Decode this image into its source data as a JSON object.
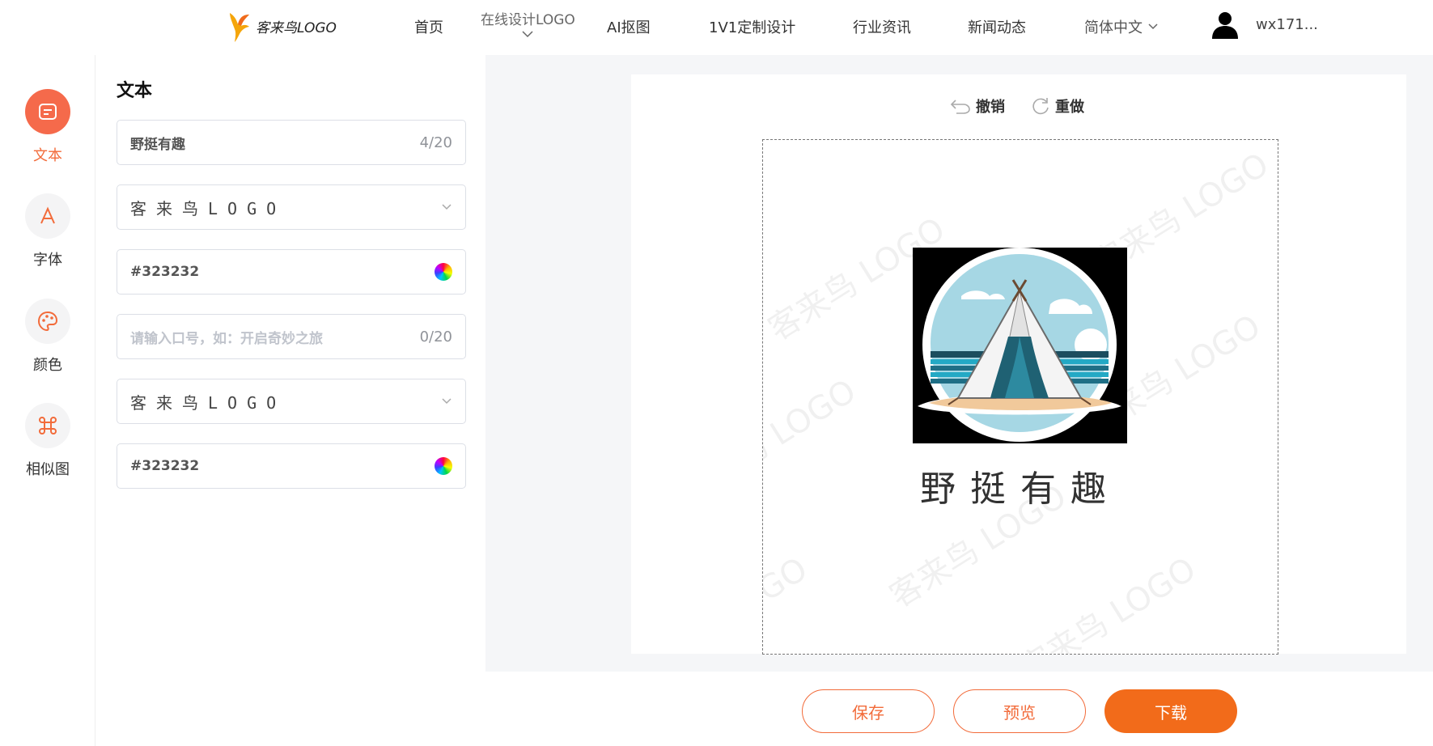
{
  "header": {
    "logo_text": "客来鸟LOGO",
    "nav": [
      {
        "label": "首页"
      },
      {
        "label": "在线设计LOGO"
      },
      {
        "label": "AI抠图"
      },
      {
        "label": "1V1定制设计"
      },
      {
        "label": "行业资讯"
      },
      {
        "label": "新闻动态"
      }
    ],
    "language": "简体中文",
    "username": "wx171..."
  },
  "rail": {
    "items": [
      {
        "label": "文本",
        "icon": "text-icon",
        "active": true
      },
      {
        "label": "字体",
        "icon": "font-icon"
      },
      {
        "label": "颜色",
        "icon": "palette-icon"
      },
      {
        "label": "相似图",
        "icon": "command-icon"
      }
    ]
  },
  "panel": {
    "title": "文本",
    "brand_input": {
      "value": "野挺有趣",
      "count": "4/20"
    },
    "brand_font": {
      "preview": "客来鸟LOGO"
    },
    "brand_color": {
      "value": "#323232"
    },
    "slogan_input": {
      "placeholder": "请输入口号，如：开启奇妙之旅",
      "count": "0/20"
    },
    "slogan_font": {
      "preview": "客来鸟LOGO"
    },
    "slogan_color": {
      "value": "#323232"
    }
  },
  "canvas": {
    "undo_label": "撤销",
    "redo_label": "重做",
    "watermark": "客来鸟 LOGO",
    "brand_text": "野挺有趣",
    "text_color": "#323232"
  },
  "actions": {
    "save": "保存",
    "preview": "预览",
    "download": "下载"
  },
  "colors": {
    "accent": "#f26b3a",
    "active_rail": "#f56a4b"
  }
}
